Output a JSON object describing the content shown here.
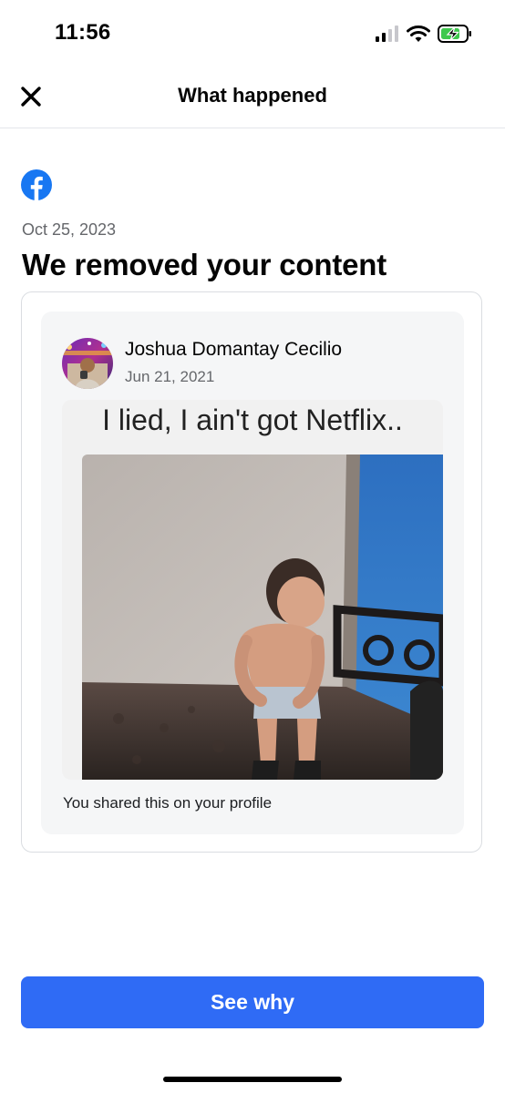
{
  "status_bar": {
    "time": "11:56",
    "icons": [
      "cellular-signal-icon",
      "wifi-icon",
      "battery-charging-icon"
    ]
  },
  "header": {
    "title": "What happened",
    "close_icon": "close-icon"
  },
  "notice": {
    "brand_icon": "facebook-logo-icon",
    "brand_color": "#1877f2",
    "date": "Oct 25, 2023",
    "headline": "We removed your content"
  },
  "post": {
    "author": "Joshua Domantay Cecilio",
    "date": "Jun 21, 2021",
    "image_caption": "I lied, I ain't got Netflix..",
    "shared_note": "You shared this on your profile"
  },
  "primary_action": {
    "label": "See why",
    "color": "#2f6bf5"
  }
}
